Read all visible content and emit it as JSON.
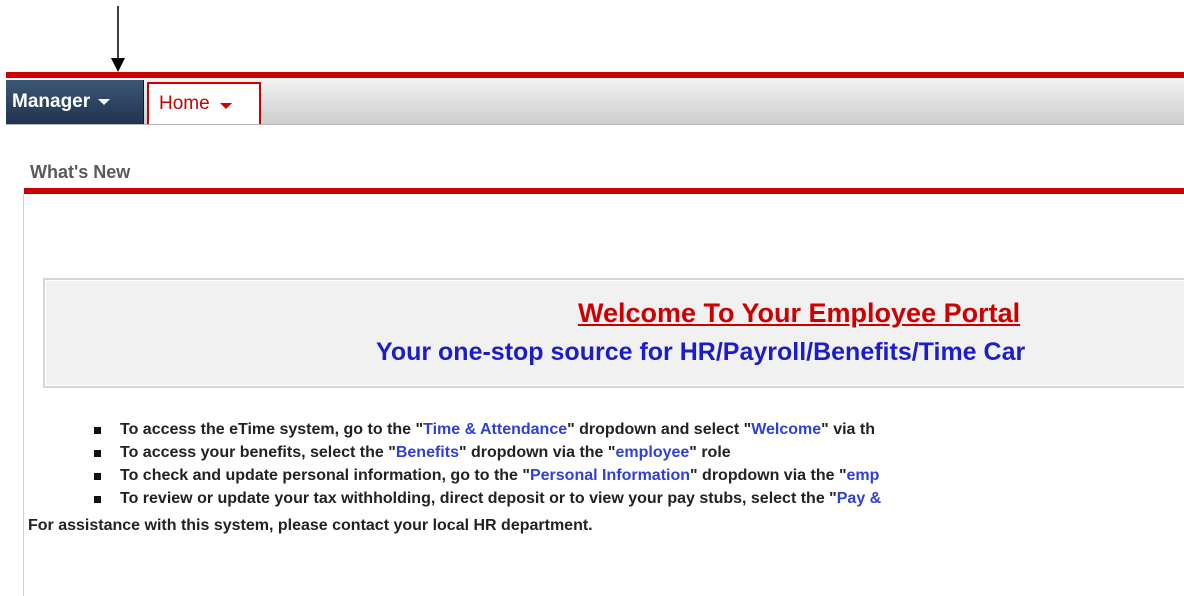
{
  "menubar": {
    "role_label": "Manager",
    "home_tab_label": "Home"
  },
  "section": {
    "title": "What's New"
  },
  "welcome": {
    "title": "Welcome To Your Employee Portal",
    "subtitle": "Your one-stop source for HR/Payroll/Benefits/Time Car"
  },
  "bullets": [
    {
      "t1": "To access the eTime system, go to the \"",
      "l1": "Time & Attendance",
      "t2": "\" dropdown and select \"",
      "l2": "Welcome",
      "t3": "\" via th"
    },
    {
      "t1": "To access your benefits, select the \"",
      "l1": "Benefits",
      "t2": "\" dropdown via the \"",
      "l2": "employee",
      "t3": "\" role"
    },
    {
      "t1": "To check and update personal information, go to the \"",
      "l1": "Personal Information",
      "t2": "\" dropdown via the \"",
      "l2": "emp",
      "t3": ""
    },
    {
      "t1": "To review or update your tax withholding, direct deposit or to view your pay stubs, select the \"",
      "l1": "Pay &",
      "t2": "",
      "l2": "",
      "t3": ""
    }
  ],
  "assistance_text": "For assistance with this system, please contact your local HR department.",
  "colors": {
    "accent_red": "#cc0000",
    "role_button_bg": "#1f3450",
    "link_blue": "#2f3fd9"
  }
}
